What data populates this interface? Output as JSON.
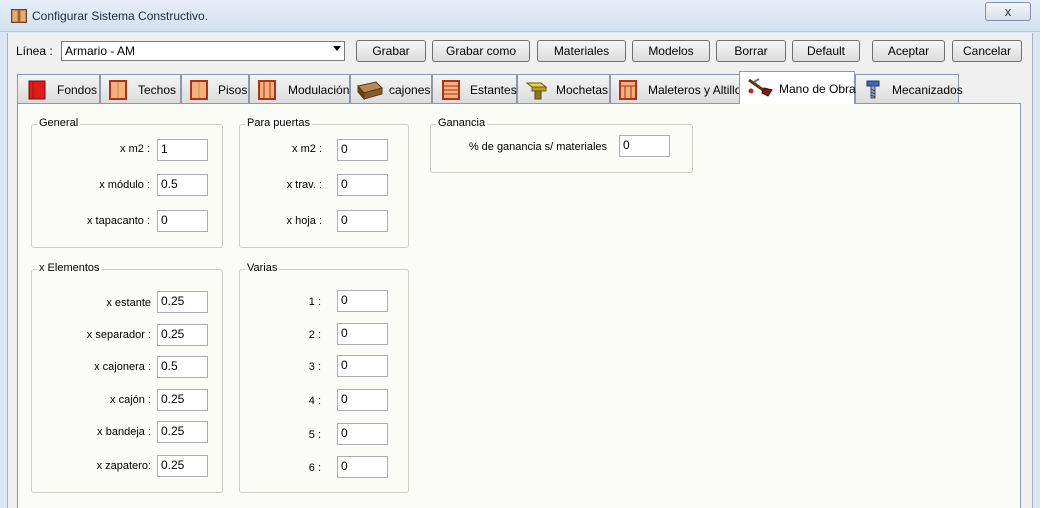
{
  "window": {
    "title": "Configurar Sistema Constructivo.",
    "close_symbol": "x"
  },
  "toolbar": {
    "linea_label": "Línea :",
    "linea_value": "Armario - AM",
    "buttons": [
      "Grabar",
      "Grabar como",
      "Materiales",
      "Modelos",
      "Borrar",
      "Default",
      "Aceptar",
      "Cancelar"
    ]
  },
  "tabs": [
    {
      "label": "Fondos",
      "icon": "red-panel-icon"
    },
    {
      "label": "Techos",
      "icon": "wood-panel-icon"
    },
    {
      "label": "Pisos",
      "icon": "wood-panel-icon"
    },
    {
      "label": "Modulación",
      "icon": "modulation-icon"
    },
    {
      "label": "cajones",
      "icon": "drawer-icon"
    },
    {
      "label": "Estantes",
      "icon": "shelves-icon"
    },
    {
      "label": "Mochetas",
      "icon": "mocheta-icon"
    },
    {
      "label": "Maleteros y Altillos",
      "icon": "cabinet-icon"
    },
    {
      "label": "Mano de Obra",
      "icon": "labor-tools-icon"
    },
    {
      "label": "Mecanizados",
      "icon": "drill-bit-icon"
    }
  ],
  "active_tab": "Mano de Obra",
  "general": {
    "title": "General",
    "fields": [
      {
        "label": "x m2 :",
        "value": "1"
      },
      {
        "label": "x módulo :",
        "value": "0.5"
      },
      {
        "label": "x tapacanto :",
        "value": "0"
      }
    ]
  },
  "puertas": {
    "title": "Para puertas",
    "fields": [
      {
        "label": "x m2 :",
        "value": "0"
      },
      {
        "label": "x trav. :",
        "value": "0"
      },
      {
        "label": "x hoja :",
        "value": "0"
      }
    ]
  },
  "ganancia": {
    "title": "Ganancia",
    "fields": [
      {
        "label": "% de ganancia s/ materiales",
        "value": "0"
      }
    ]
  },
  "elementos": {
    "title": "x Elementos",
    "fields": [
      {
        "label": "x estante",
        "value": "0.25"
      },
      {
        "label": "x separador :",
        "value": "0.25"
      },
      {
        "label": "x cajonera :",
        "value": "0.5"
      },
      {
        "label": "x cajón :",
        "value": "0.25"
      },
      {
        "label": "x bandeja :",
        "value": "0.25"
      },
      {
        "label": "x  zapatero:",
        "value": "0.25"
      }
    ]
  },
  "varias": {
    "title": "Varias",
    "fields": [
      {
        "label": "1 :",
        "value": "0"
      },
      {
        "label": "2 :",
        "value": "0"
      },
      {
        "label": "3 :",
        "value": "0"
      },
      {
        "label": "4 :",
        "value": "0"
      },
      {
        "label": "5 :",
        "value": "0"
      },
      {
        "label": "6 :",
        "value": "0"
      }
    ]
  }
}
